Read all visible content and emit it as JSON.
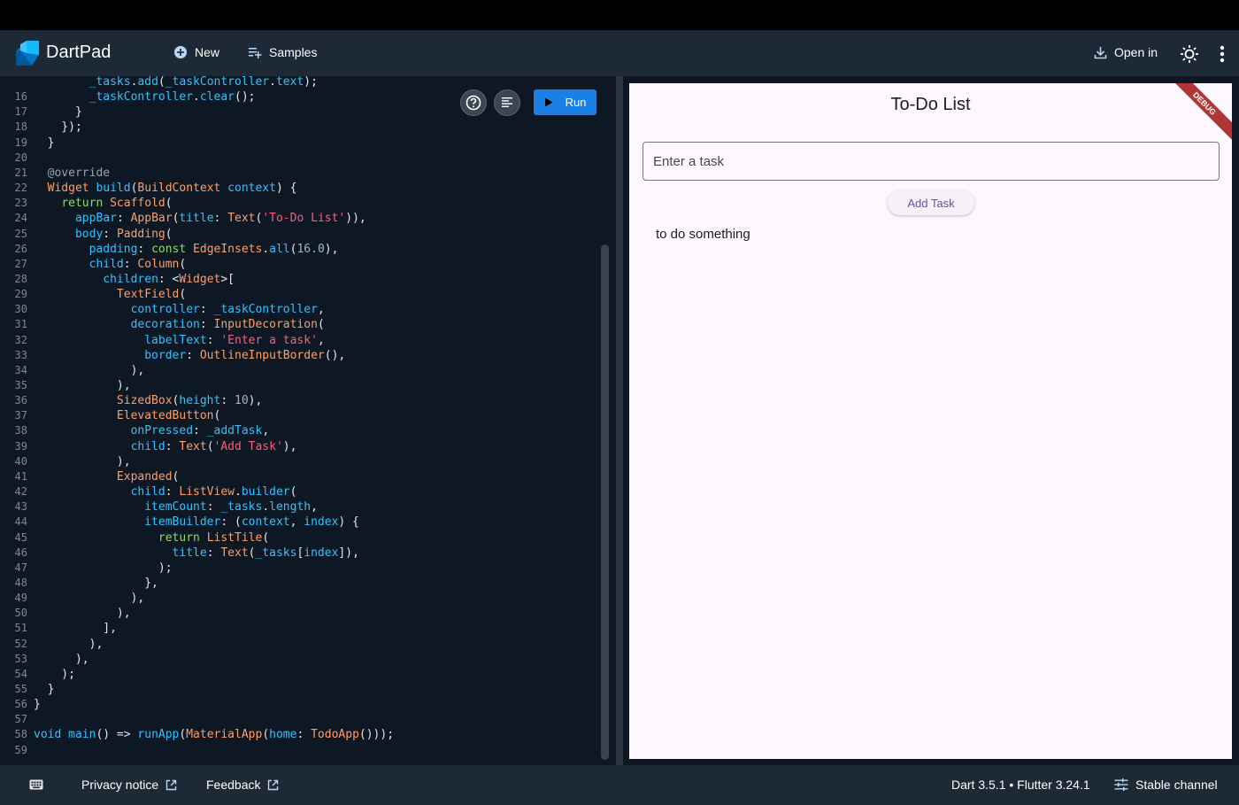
{
  "header": {
    "app_title": "DartPad",
    "new_label": "New",
    "samples_label": "Samples",
    "open_in_label": "Open in"
  },
  "editor": {
    "run_label": "Run",
    "lines": [
      {
        "n": "",
        "tokens": [
          [
            "tx",
            "        "
          ],
          [
            "pr",
            "_tasks"
          ],
          [
            "tx",
            "."
          ],
          [
            "fn",
            "add"
          ],
          [
            "tx",
            "("
          ],
          [
            "pr",
            "_taskController"
          ],
          [
            "tx",
            "."
          ],
          [
            "pr",
            "text"
          ],
          [
            "tx",
            ");"
          ]
        ]
      },
      {
        "n": "16",
        "tokens": [
          [
            "tx",
            "        "
          ],
          [
            "pr",
            "_taskController"
          ],
          [
            "tx",
            "."
          ],
          [
            "fn",
            "clear"
          ],
          [
            "tx",
            "();"
          ]
        ]
      },
      {
        "n": "17",
        "tokens": [
          [
            "tx",
            "      }"
          ]
        ]
      },
      {
        "n": "18",
        "tokens": [
          [
            "tx",
            "    });"
          ]
        ]
      },
      {
        "n": "19",
        "tokens": [
          [
            "tx",
            "  }"
          ]
        ]
      },
      {
        "n": "20",
        "tokens": [
          [
            "tx",
            ""
          ]
        ]
      },
      {
        "n": "21",
        "tokens": [
          [
            "an",
            "  @override"
          ]
        ]
      },
      {
        "n": "22",
        "tokens": [
          [
            "tx",
            "  "
          ],
          [
            "ty",
            "Widget"
          ],
          [
            "tx",
            " "
          ],
          [
            "fn",
            "build"
          ],
          [
            "tx",
            "("
          ],
          [
            "ty",
            "BuildContext"
          ],
          [
            "tx",
            " "
          ],
          [
            "pr",
            "context"
          ],
          [
            "tx",
            ") {"
          ]
        ]
      },
      {
        "n": "23",
        "tokens": [
          [
            "tx",
            "    "
          ],
          [
            "gr",
            "return"
          ],
          [
            "tx",
            " "
          ],
          [
            "ty",
            "Scaffold"
          ],
          [
            "tx",
            "("
          ]
        ]
      },
      {
        "n": "24",
        "tokens": [
          [
            "tx",
            "      "
          ],
          [
            "pr",
            "appBar"
          ],
          [
            "tx",
            ": "
          ],
          [
            "ty",
            "AppBar"
          ],
          [
            "tx",
            "("
          ],
          [
            "pr",
            "title"
          ],
          [
            "tx",
            ": "
          ],
          [
            "ty",
            "Text"
          ],
          [
            "tx",
            "("
          ],
          [
            "st",
            "'To-Do List'"
          ],
          [
            "tx",
            ")),"
          ]
        ]
      },
      {
        "n": "25",
        "tokens": [
          [
            "tx",
            "      "
          ],
          [
            "pr",
            "body"
          ],
          [
            "tx",
            ": "
          ],
          [
            "ty",
            "Padding"
          ],
          [
            "tx",
            "("
          ]
        ]
      },
      {
        "n": "26",
        "tokens": [
          [
            "tx",
            "        "
          ],
          [
            "pr",
            "padding"
          ],
          [
            "tx",
            ": "
          ],
          [
            "gr",
            "const"
          ],
          [
            "tx",
            " "
          ],
          [
            "ty",
            "EdgeInsets"
          ],
          [
            "tx",
            "."
          ],
          [
            "fn",
            "all"
          ],
          [
            "tx",
            "("
          ],
          [
            "nu",
            "16.0"
          ],
          [
            "tx",
            "),"
          ]
        ]
      },
      {
        "n": "27",
        "tokens": [
          [
            "tx",
            "        "
          ],
          [
            "pr",
            "child"
          ],
          [
            "tx",
            ": "
          ],
          [
            "ty",
            "Column"
          ],
          [
            "tx",
            "("
          ]
        ]
      },
      {
        "n": "28",
        "tokens": [
          [
            "tx",
            "          "
          ],
          [
            "pr",
            "children"
          ],
          [
            "tx",
            ": <"
          ],
          [
            "ty",
            "Widget"
          ],
          [
            "tx",
            ">["
          ]
        ]
      },
      {
        "n": "29",
        "tokens": [
          [
            "tx",
            "            "
          ],
          [
            "ty",
            "TextField"
          ],
          [
            "tx",
            "("
          ]
        ]
      },
      {
        "n": "30",
        "tokens": [
          [
            "tx",
            "              "
          ],
          [
            "pr",
            "controller"
          ],
          [
            "tx",
            ": "
          ],
          [
            "pr",
            "_taskController"
          ],
          [
            "tx",
            ","
          ]
        ]
      },
      {
        "n": "31",
        "tokens": [
          [
            "tx",
            "              "
          ],
          [
            "pr",
            "decoration"
          ],
          [
            "tx",
            ": "
          ],
          [
            "ty",
            "InputDecoration"
          ],
          [
            "tx",
            "("
          ]
        ]
      },
      {
        "n": "32",
        "tokens": [
          [
            "tx",
            "                "
          ],
          [
            "pr",
            "labelText"
          ],
          [
            "tx",
            ": "
          ],
          [
            "st",
            "'Enter a task'"
          ],
          [
            "tx",
            ","
          ]
        ]
      },
      {
        "n": "33",
        "tokens": [
          [
            "tx",
            "                "
          ],
          [
            "pr",
            "border"
          ],
          [
            "tx",
            ": "
          ],
          [
            "ty",
            "OutlineInputBorder"
          ],
          [
            "tx",
            "(),"
          ]
        ]
      },
      {
        "n": "34",
        "tokens": [
          [
            "tx",
            "              ),"
          ]
        ]
      },
      {
        "n": "35",
        "tokens": [
          [
            "tx",
            "            ),"
          ]
        ]
      },
      {
        "n": "36",
        "tokens": [
          [
            "tx",
            "            "
          ],
          [
            "ty",
            "SizedBox"
          ],
          [
            "tx",
            "("
          ],
          [
            "pr",
            "height"
          ],
          [
            "tx",
            ": "
          ],
          [
            "nu",
            "10"
          ],
          [
            "tx",
            "),"
          ]
        ]
      },
      {
        "n": "37",
        "tokens": [
          [
            "tx",
            "            "
          ],
          [
            "ty",
            "ElevatedButton"
          ],
          [
            "tx",
            "("
          ]
        ]
      },
      {
        "n": "38",
        "tokens": [
          [
            "tx",
            "              "
          ],
          [
            "pr",
            "onPressed"
          ],
          [
            "tx",
            ": "
          ],
          [
            "pr",
            "_addTask"
          ],
          [
            "tx",
            ","
          ]
        ]
      },
      {
        "n": "39",
        "tokens": [
          [
            "tx",
            "              "
          ],
          [
            "pr",
            "child"
          ],
          [
            "tx",
            ": "
          ],
          [
            "ty",
            "Text"
          ],
          [
            "tx",
            "("
          ],
          [
            "st",
            "'Add Task'"
          ],
          [
            "tx",
            "),"
          ]
        ]
      },
      {
        "n": "40",
        "tokens": [
          [
            "tx",
            "            ),"
          ]
        ]
      },
      {
        "n": "41",
        "tokens": [
          [
            "tx",
            "            "
          ],
          [
            "ty",
            "Expanded"
          ],
          [
            "tx",
            "("
          ]
        ]
      },
      {
        "n": "42",
        "tokens": [
          [
            "tx",
            "              "
          ],
          [
            "pr",
            "child"
          ],
          [
            "tx",
            ": "
          ],
          [
            "ty",
            "ListView"
          ],
          [
            "tx",
            "."
          ],
          [
            "fn",
            "builder"
          ],
          [
            "tx",
            "("
          ]
        ]
      },
      {
        "n": "43",
        "tokens": [
          [
            "tx",
            "                "
          ],
          [
            "pr",
            "itemCount"
          ],
          [
            "tx",
            ": "
          ],
          [
            "pr",
            "_tasks"
          ],
          [
            "tx",
            "."
          ],
          [
            "pr",
            "length"
          ],
          [
            "tx",
            ","
          ]
        ]
      },
      {
        "n": "44",
        "tokens": [
          [
            "tx",
            "                "
          ],
          [
            "pr",
            "itemBuilder"
          ],
          [
            "tx",
            ": ("
          ],
          [
            "pr",
            "context"
          ],
          [
            "tx",
            ", "
          ],
          [
            "pr",
            "index"
          ],
          [
            "tx",
            ") {"
          ]
        ]
      },
      {
        "n": "45",
        "tokens": [
          [
            "tx",
            "                  "
          ],
          [
            "gr",
            "return"
          ],
          [
            "tx",
            " "
          ],
          [
            "ty",
            "ListTile"
          ],
          [
            "tx",
            "("
          ]
        ]
      },
      {
        "n": "46",
        "tokens": [
          [
            "tx",
            "                    "
          ],
          [
            "pr",
            "title"
          ],
          [
            "tx",
            ": "
          ],
          [
            "ty",
            "Text"
          ],
          [
            "tx",
            "("
          ],
          [
            "pr",
            "_tasks"
          ],
          [
            "tx",
            "["
          ],
          [
            "pr",
            "index"
          ],
          [
            "tx",
            "]),"
          ]
        ]
      },
      {
        "n": "47",
        "tokens": [
          [
            "tx",
            "                  );"
          ]
        ]
      },
      {
        "n": "48",
        "tokens": [
          [
            "tx",
            "                },"
          ]
        ]
      },
      {
        "n": "49",
        "tokens": [
          [
            "tx",
            "              ),"
          ]
        ]
      },
      {
        "n": "50",
        "tokens": [
          [
            "tx",
            "            ),"
          ]
        ]
      },
      {
        "n": "51",
        "tokens": [
          [
            "tx",
            "          ],"
          ]
        ]
      },
      {
        "n": "52",
        "tokens": [
          [
            "tx",
            "        ),"
          ]
        ]
      },
      {
        "n": "53",
        "tokens": [
          [
            "tx",
            "      ),"
          ]
        ]
      },
      {
        "n": "54",
        "tokens": [
          [
            "tx",
            "    );"
          ]
        ]
      },
      {
        "n": "55",
        "tokens": [
          [
            "tx",
            "  }"
          ]
        ]
      },
      {
        "n": "56",
        "tokens": [
          [
            "tx",
            "}"
          ]
        ]
      },
      {
        "n": "57",
        "tokens": [
          [
            "tx",
            ""
          ]
        ]
      },
      {
        "n": "58",
        "tokens": [
          [
            "tx",
            ""
          ],
          [
            "pr",
            "void"
          ],
          [
            "tx",
            " "
          ],
          [
            "fn",
            "main"
          ],
          [
            "tx",
            "() => "
          ],
          [
            "fn",
            "runApp"
          ],
          [
            "tx",
            "("
          ],
          [
            "ty",
            "MaterialApp"
          ],
          [
            "tx",
            "("
          ],
          [
            "pr",
            "home"
          ],
          [
            "tx",
            ": "
          ],
          [
            "ty",
            "TodoApp"
          ],
          [
            "tx",
            "()));"
          ]
        ]
      },
      {
        "n": "59",
        "tokens": [
          [
            "tx",
            ""
          ]
        ]
      }
    ]
  },
  "preview": {
    "app_bar_title": "To-Do List",
    "debug_banner": "DEBUG",
    "input_label": "Enter a task",
    "add_task_label": "Add Task",
    "tasks": [
      "to do something"
    ]
  },
  "footer": {
    "privacy_label": "Privacy notice",
    "feedback_label": "Feedback",
    "version_label": "Dart 3.5.1 • Flutter 3.24.1",
    "channel_label": "Stable channel"
  },
  "colors": {
    "header_bg": "#1d2935",
    "editor_bg": "#0d1824",
    "run_button": "#1a80e6",
    "preview_bg": "#fdf7ff",
    "accent_purple": "#6750a4"
  },
  "icons": [
    "dart-logo",
    "add-circle-icon",
    "playlist-add-icon",
    "download-icon",
    "brightness-icon",
    "more-vert-icon",
    "help-icon",
    "format-icon",
    "play-icon",
    "keyboard-icon",
    "open-in-new-icon",
    "tune-icon"
  ]
}
